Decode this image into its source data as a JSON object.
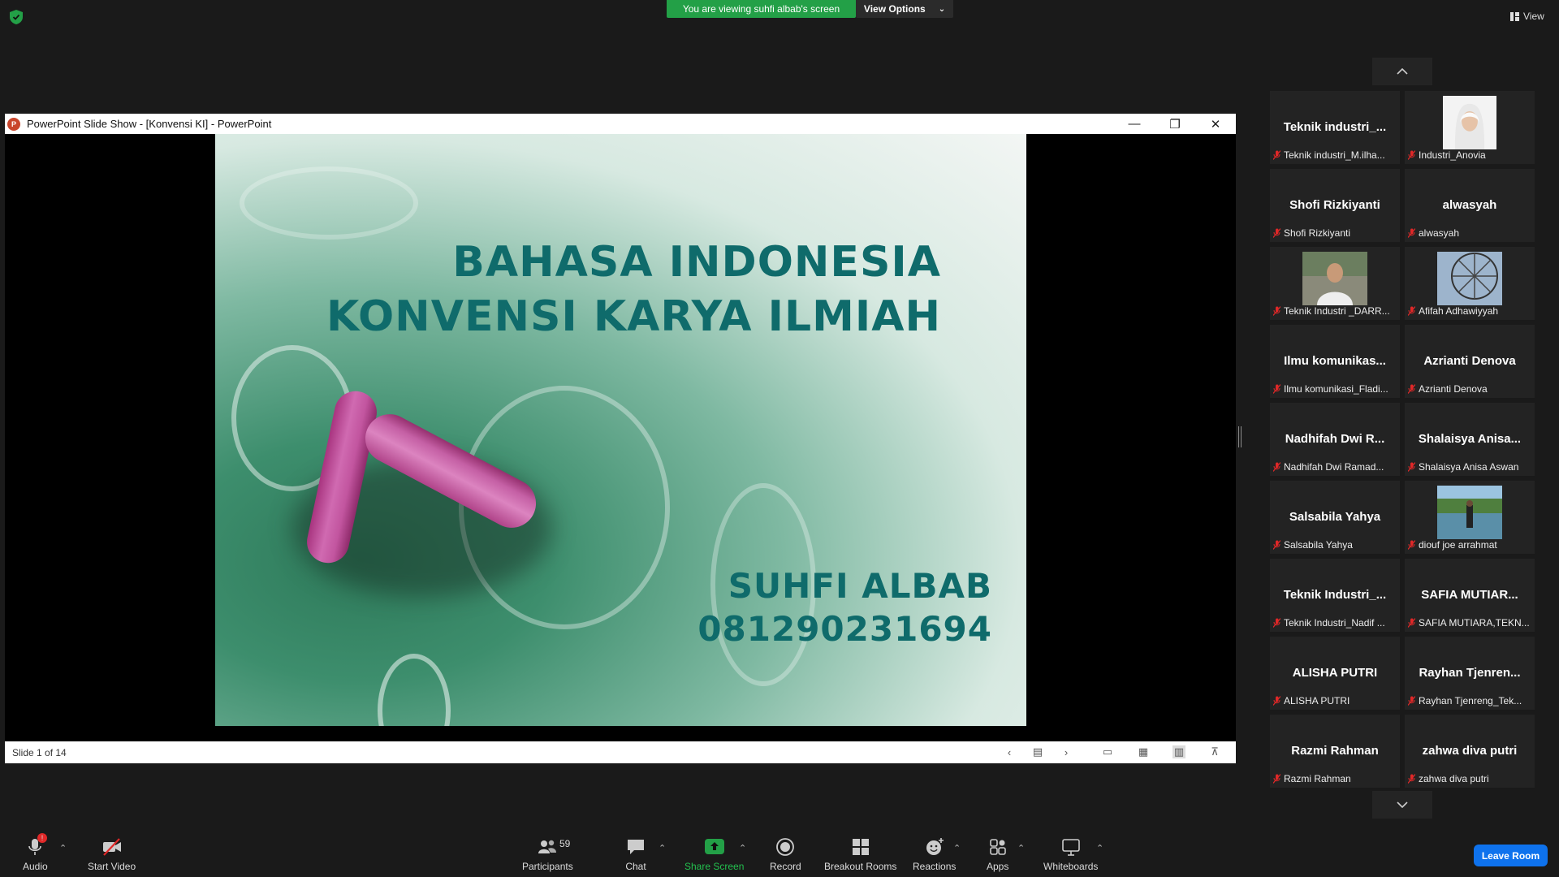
{
  "banner": {
    "viewing_text": "You are viewing suhfi albab's screen",
    "view_options_label": "View Options",
    "view_label": "View"
  },
  "ppt": {
    "window_title": "PowerPoint Slide Show - [Konvensi KI] - PowerPoint",
    "slide_status": "Slide 1 of 14",
    "slide": {
      "title_line1": "BAHASA INDONESIA",
      "title_line2": "KONVENSI KARYA ILMIAH",
      "author": "SUHFI ALBAB",
      "phone": "081290231694"
    }
  },
  "participants": [
    {
      "big": "Teknik  industri_...",
      "small": "Teknik industri_M.ilha..."
    },
    {
      "big": "",
      "small": "Industri_Anovia",
      "avatar": "hijab-woman-photo"
    },
    {
      "big": "Shofi Rizkiyanti",
      "small": "Shofi Rizkiyanti"
    },
    {
      "big": "alwasyah",
      "small": "alwasyah"
    },
    {
      "big": "",
      "small": "Teknik Industri _DARR...",
      "avatar": "man-photo"
    },
    {
      "big": "",
      "small": "Afifah Adhawiyyah",
      "avatar": "ferris-wheel-photo"
    },
    {
      "big": "Ilmu  komunikas...",
      "small": "Ilmu komunikasi_Fladi..."
    },
    {
      "big": "Azrianti Denova",
      "small": "Azrianti Denova"
    },
    {
      "big": "Nadhifah  Dwi  R...",
      "small": "Nadhifah Dwi Ramad..."
    },
    {
      "big": "Shalaisya  Anisa...",
      "small": "Shalaisya Anisa Aswan"
    },
    {
      "big": "Salsabila Yahya",
      "small": "Salsabila Yahya"
    },
    {
      "big": "",
      "small": "diouf joe arrahmat",
      "avatar": "lake-photo"
    },
    {
      "big": "Teknik  Industri_...",
      "small": "Teknik Industri_Nadif ..."
    },
    {
      "big": "SAFIA  MUTIAR...",
      "small": "SAFIA MUTIARA,TEKN..."
    },
    {
      "big": "ALISHA PUTRI",
      "small": "ALISHA PUTRI"
    },
    {
      "big": "Rayhan  Tjenren...",
      "small": "Rayhan Tjenreng_Tek..."
    },
    {
      "big": "Razmi Rahman",
      "small": "Razmi Rahman"
    },
    {
      "big": "zahwa diva putri",
      "small": "zahwa diva putri"
    }
  ],
  "toolbar": {
    "audio": "Audio",
    "audio_badge": "!",
    "start_video": "Start Video",
    "participants": "Participants",
    "participants_count": "59",
    "chat": "Chat",
    "share_screen": "Share Screen",
    "record": "Record",
    "breakout_rooms": "Breakout Rooms",
    "reactions": "Reactions",
    "apps": "Apps",
    "whiteboards": "Whiteboards",
    "leave_room": "Leave Room"
  },
  "colors": {
    "share_green": "#23a047",
    "leave_blue": "#0e72ed",
    "slide_title": "#0f6b6b",
    "muted_red": "#e02828"
  }
}
